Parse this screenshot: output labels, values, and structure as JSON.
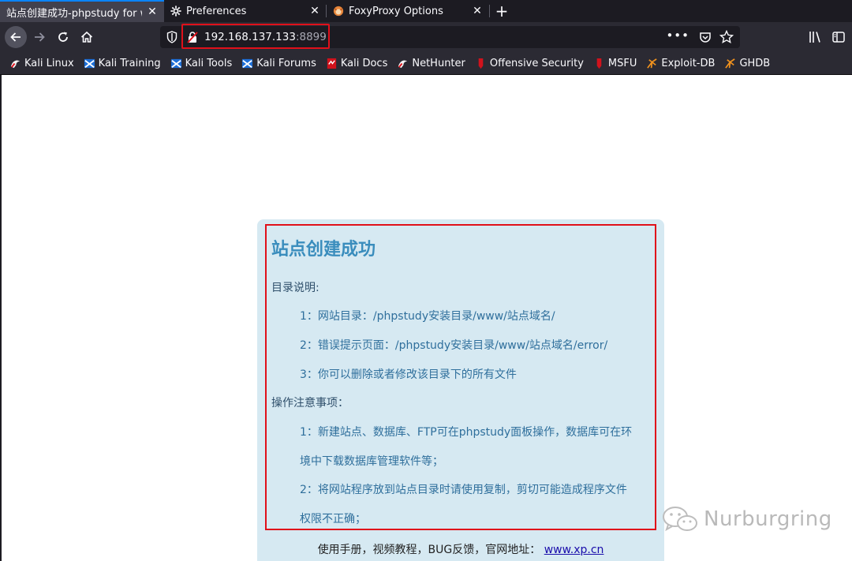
{
  "tabs": [
    {
      "title": "站点创建成功-phpstudy for w",
      "icon": "page-icon",
      "active": true
    },
    {
      "title": "Preferences",
      "icon": "gear-icon",
      "active": false
    },
    {
      "title": "FoxyProxy Options",
      "icon": "foxyproxy-icon",
      "active": false
    }
  ],
  "urlbar": {
    "host": "192.168.137.133",
    "port": ":8899",
    "more_label": "•••"
  },
  "bookmarks": [
    {
      "label": "Kali Linux",
      "icon": "kali-linux-icon"
    },
    {
      "label": "Kali Training",
      "icon": "kali-training-icon"
    },
    {
      "label": "Kali Tools",
      "icon": "kali-tools-icon"
    },
    {
      "label": "Kali Forums",
      "icon": "kali-forums-icon"
    },
    {
      "label": "Kali Docs",
      "icon": "kali-docs-icon"
    },
    {
      "label": "NetHunter",
      "icon": "nethunter-icon"
    },
    {
      "label": "Offensive Security",
      "icon": "offsec-icon"
    },
    {
      "label": "MSFU",
      "icon": "msfu-icon"
    },
    {
      "label": "Exploit-DB",
      "icon": "exploit-db-icon"
    },
    {
      "label": "GHDB",
      "icon": "ghdb-icon"
    }
  ],
  "card": {
    "title": "站点创建成功",
    "dir_heading": "目录说明:",
    "dir_items": [
      "1：网站目录：/phpstudy安装目录/www/站点域名/",
      "2：错误提示页面：/phpstudy安装目录/www/站点域名/error/",
      "3：你可以删除或者修改该目录下的所有文件"
    ],
    "notes_heading": "操作注意事项：",
    "notes_items": [
      "1：新建站点、数据库、FTP可在phpstudy面板操作，数据库可在环",
      "境中下载数据库管理软件等；",
      "2：将网站程序放到站点目录时请使用复制，剪切可能造成程序文件",
      "权限不正确；"
    ],
    "footer_text": "使用手册，视频教程，BUG反馈，官网地址：",
    "footer_link": "www.xp.cn"
  },
  "watermark": {
    "text": "Nurburgring"
  },
  "colors": {
    "highlight_border": "#e0101a",
    "card_bg": "#d6e9f2",
    "title_blue": "#3a8dbd",
    "chrome_bg": "#2b2a33"
  }
}
